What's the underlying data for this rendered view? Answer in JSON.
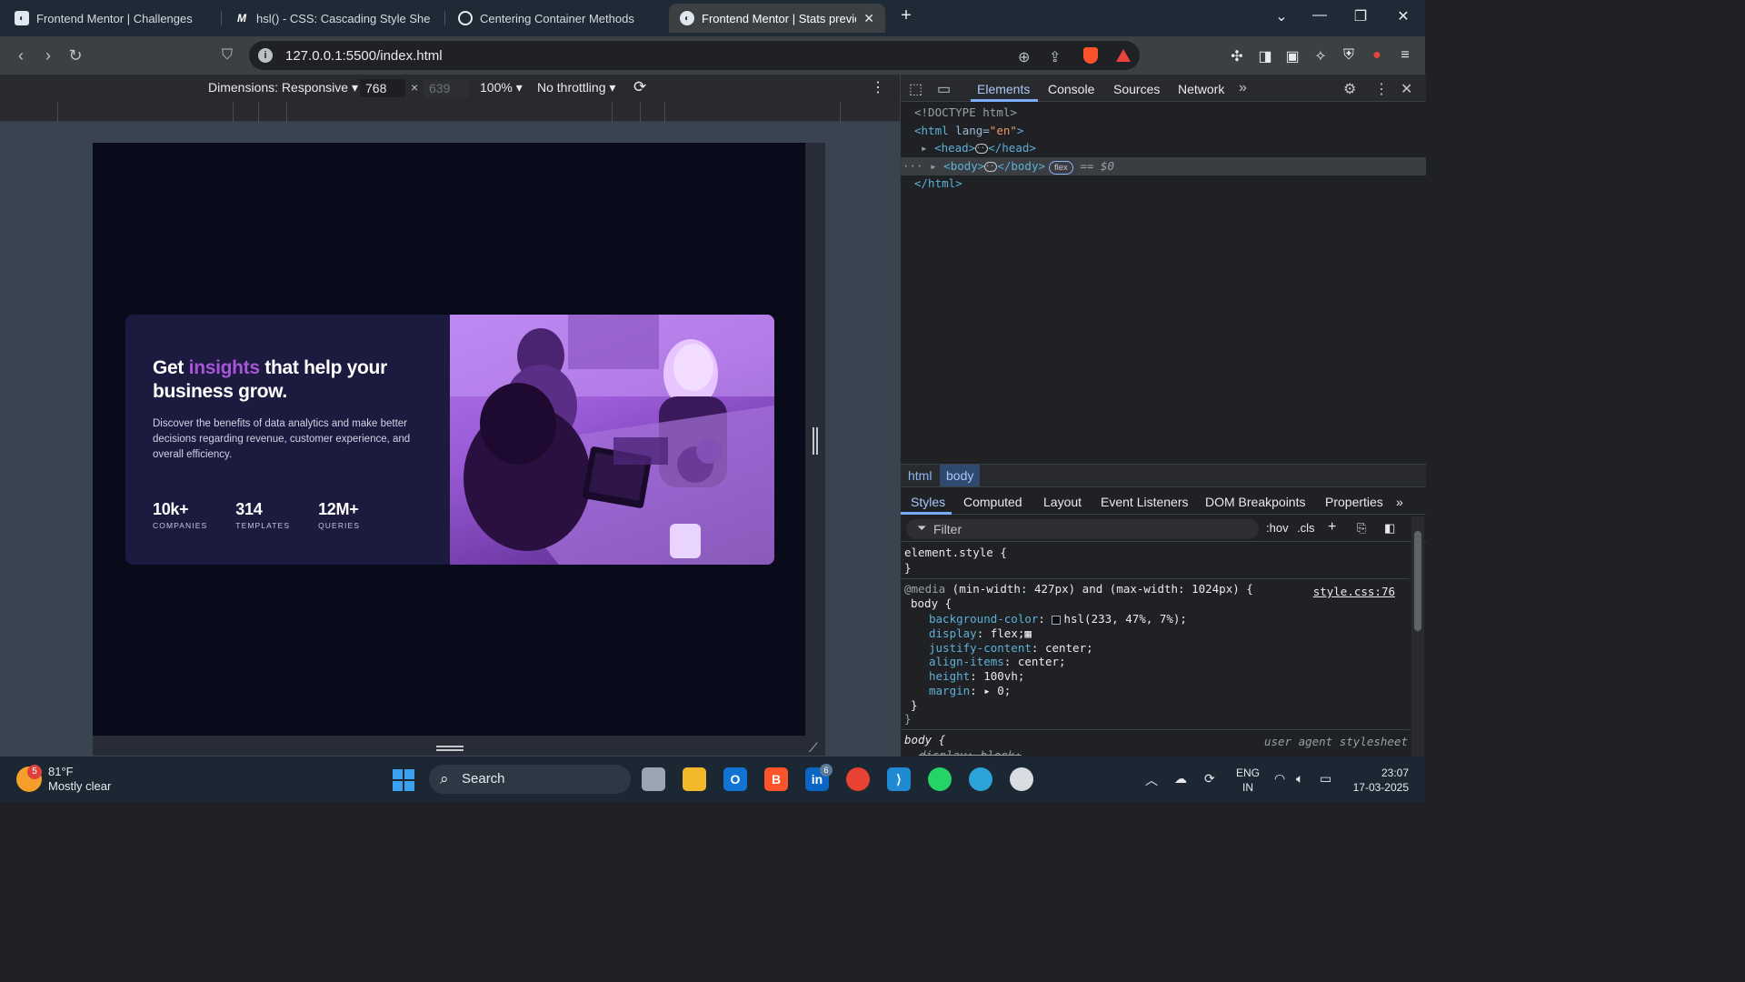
{
  "browser": {
    "tabs": [
      {
        "title": "Frontend Mentor | Challenges",
        "icon": "frontend-mentor-icon"
      },
      {
        "title": "hsl() - CSS: Cascading Style Sheets |",
        "icon": "mdn-icon"
      },
      {
        "title": "Centering Container Methods",
        "icon": "openai-icon"
      },
      {
        "title": "Frontend Mentor | Stats preview",
        "icon": "frontend-mentor-icon",
        "active": true
      }
    ],
    "new_tab_label": "+",
    "url": "127.0.0.1:5500/index.html"
  },
  "device_toolbar": {
    "dimensions_label": "Dimensions: Responsive",
    "width": "768",
    "height": "639",
    "zoom": "100%",
    "throttling": "No throttling"
  },
  "card": {
    "title_pre": "Get ",
    "title_accent": "insights",
    "title_post": " that help your business grow.",
    "description": "Discover the benefits of data analytics and make better decisions regarding revenue, customer experience, and overall efficiency.",
    "stats": [
      {
        "value": "10k+",
        "label": "COMPANIES"
      },
      {
        "value": "314",
        "label": "TEMPLATES"
      },
      {
        "value": "12M+",
        "label": "QUERIES"
      }
    ],
    "accent_color": "#a855d8",
    "background_color": "#1c1a3e",
    "page_background": "#090b1b"
  },
  "devtools": {
    "tabs": [
      "Elements",
      "Console",
      "Sources",
      "Network"
    ],
    "active_tab": "Elements",
    "dom": {
      "doctype": "<!DOCTYPE html>",
      "html_open_tag": "<html",
      "html_attr": " lang=",
      "html_attr_val": "\"en\"",
      "html_close_bracket": ">",
      "head_open": "<head>",
      "head_close": "</head>",
      "body_open": "<body>",
      "body_close": "</body>",
      "flex_badge": "flex",
      "selected_marker": "== $0",
      "html_close": "</html>"
    },
    "breadcrumbs": [
      "html",
      "body"
    ],
    "panel_tabs": [
      "Styles",
      "Computed",
      "Layout",
      "Event Listeners",
      "DOM Breakpoints",
      "Properties"
    ],
    "filter_placeholder": "Filter",
    "filter_tools": [
      ":hov",
      ".cls"
    ],
    "styles": {
      "element_style_open": "element.style {",
      "close_brace": "}",
      "media_prefix": "@media",
      "media_query": " (min-width: 427px) and (max-width: 1024px) {",
      "source": "style.css:76",
      "selector": "body {",
      "declarations": [
        {
          "prop": "background-color",
          "value": "hsl(233, 47%, 7%);"
        },
        {
          "prop": "display",
          "value": "flex;"
        },
        {
          "prop": "justify-content",
          "value": "center;"
        },
        {
          "prop": "align-items",
          "value": "center;"
        },
        {
          "prop": "height",
          "value": "100vh;"
        },
        {
          "prop": "margin",
          "value": "▸ 0;"
        }
      ],
      "ua_selector": "body {",
      "ua_label": "user agent stylesheet",
      "ua_decl": "display: block;"
    }
  },
  "taskbar": {
    "weather_badge": "5",
    "temperature": "81°F",
    "condition": "Mostly clear",
    "search_label": "Search",
    "linkedin_badge": "6",
    "language": "ENG",
    "region": "IN",
    "time": "23:07",
    "date": "17-03-2025"
  }
}
